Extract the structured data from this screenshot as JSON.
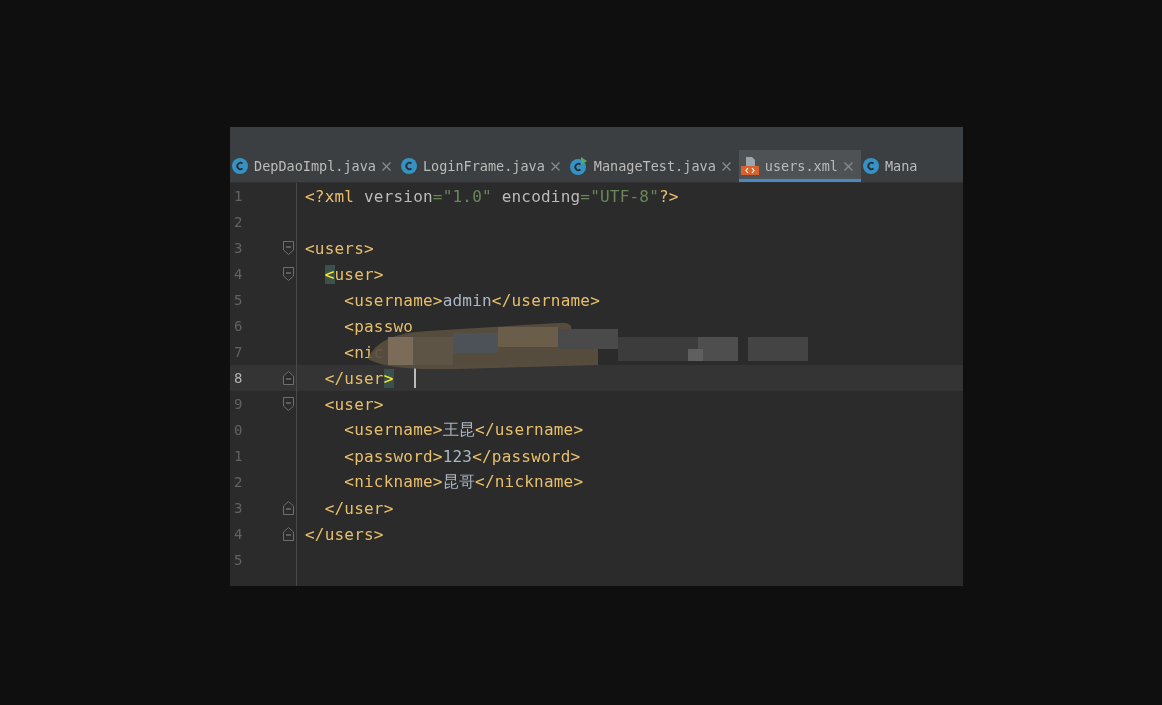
{
  "tabs": [
    {
      "label": "DepDaoImpl.java",
      "kind": "class",
      "selected": false,
      "closable": true
    },
    {
      "label": "LoginFrame.java",
      "kind": "class",
      "selected": false,
      "closable": true
    },
    {
      "label": "ManageTest.java",
      "kind": "test",
      "selected": false,
      "closable": true
    },
    {
      "label": "users.xml",
      "kind": "xml",
      "selected": true,
      "closable": true
    },
    {
      "label": "Mana",
      "kind": "class",
      "selected": false,
      "closable": false
    }
  ],
  "lines": [
    {
      "number": "1",
      "kind": "plain",
      "current": false,
      "tokens": [
        {
          "kind": "tag",
          "text": "<?xml "
        },
        {
          "kind": "attr",
          "text": "version"
        },
        {
          "kind": "value",
          "text": "=\"1.0\" "
        },
        {
          "kind": "attr",
          "text": "encoding"
        },
        {
          "kind": "value",
          "text": "=\"UTF-8\""
        },
        {
          "kind": "tag",
          "text": "?>"
        }
      ]
    },
    {
      "number": "2",
      "kind": "plain",
      "current": false
    },
    {
      "number": "3",
      "kind": "fold-start",
      "current": false,
      "tokens": [
        {
          "kind": "tag",
          "text": "<users>"
        }
      ]
    },
    {
      "number": "4",
      "kind": "fold-start",
      "current": false,
      "tokens": [
        {
          "kind": "match",
          "text": "  <"
        },
        {
          "kind": "tag",
          "text": "user>"
        }
      ]
    },
    {
      "number": "5",
      "kind": "plain",
      "current": false,
      "tokens": [
        {
          "kind": "tag",
          "text": "    <username>"
        },
        {
          "kind": "text",
          "text": "admin"
        },
        {
          "kind": "tag",
          "text": "</username>"
        }
      ]
    },
    {
      "number": "6",
      "kind": "plain",
      "current": false,
      "tokens": [
        {
          "kind": "tag",
          "text": "    <passwo"
        }
      ]
    },
    {
      "number": "7",
      "kind": "plain",
      "current": false,
      "tokens": [
        {
          "kind": "tag",
          "text": "    <nic"
        }
      ]
    },
    {
      "number": "8",
      "kind": "fold-end",
      "current": true,
      "tokens": [
        {
          "kind": "tag",
          "text": "  </user"
        },
        {
          "kind": "match",
          "text": ">"
        }
      ]
    },
    {
      "number": "9",
      "kind": "fold-start",
      "current": false,
      "tokens": [
        {
          "kind": "tag",
          "text": "  <user>"
        }
      ]
    },
    {
      "number": "0",
      "kind": "plain",
      "current": false,
      "tokens": [
        {
          "kind": "tag",
          "text": "    <username>"
        },
        {
          "kind": "text",
          "text": "王昆"
        },
        {
          "kind": "tag",
          "text": "</username>"
        }
      ]
    },
    {
      "number": "1",
      "kind": "plain",
      "current": false,
      "tokens": [
        {
          "kind": "tag",
          "text": "    <password>"
        },
        {
          "kind": "text",
          "text": "123"
        },
        {
          "kind": "tag",
          "text": "</password>"
        }
      ]
    },
    {
      "number": "2",
      "kind": "plain",
      "current": false,
      "tokens": [
        {
          "kind": "tag",
          "text": "    <nickname>"
        },
        {
          "kind": "text",
          "text": "昆哥"
        },
        {
          "kind": "tag",
          "text": "</nickname>"
        }
      ]
    },
    {
      "number": "3",
      "kind": "fold-end",
      "current": false,
      "tokens": [
        {
          "kind": "tag",
          "text": "  </user>"
        }
      ]
    },
    {
      "number": "4",
      "kind": "fold-end",
      "current": false,
      "tokens": [
        {
          "kind": "tag",
          "text": "</users>"
        }
      ]
    },
    {
      "number": "5",
      "kind": "plain",
      "current": false
    }
  ]
}
